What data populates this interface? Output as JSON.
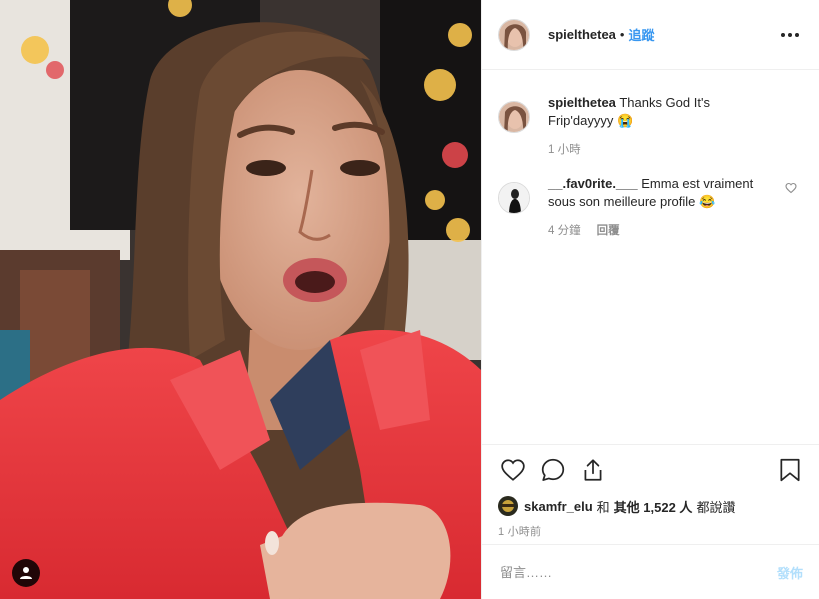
{
  "post": {
    "author": "spielthetea",
    "separator": "•",
    "follow_label": "追蹤",
    "more_icon": "more-options-icon"
  },
  "comments": [
    {
      "username": "spielthetea",
      "text": "Thanks God It's Frip'dayyyy 😭",
      "time": "1 小時"
    },
    {
      "username": "__.fav0rite.___",
      "text": "Emma est vraiment sous son meilleure profile 😂",
      "time": "4 分鐘",
      "reply_label": "回覆"
    }
  ],
  "actions": {
    "like_icon": "heart-icon",
    "comment_icon": "comment-icon",
    "share_icon": "share-icon",
    "save_icon": "bookmark-icon"
  },
  "likes": {
    "first_liker": "skamfr_elu",
    "joiner": "和",
    "others_label": "其他 1,522 人",
    "suffix": "都說讚"
  },
  "timestamp": "1 小時前",
  "add_comment": {
    "placeholder": "留言……",
    "post_label": "發佈"
  },
  "colors": {
    "link_blue": "#3897f0",
    "post_disabled": "#b2dffc",
    "coat_red": "#e8343a"
  }
}
